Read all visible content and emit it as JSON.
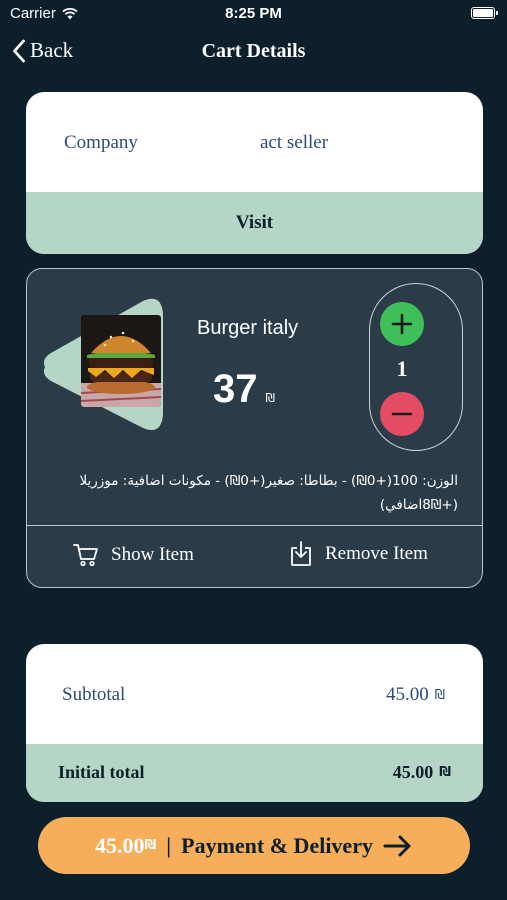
{
  "status_bar": {
    "carrier": "Carrier",
    "time": "8:25 PM"
  },
  "nav": {
    "back_label": "Back",
    "title": "Cart Details"
  },
  "company": {
    "label": "Company",
    "value": "act seller",
    "visit_label": "Visit"
  },
  "item": {
    "name": "Burger italy",
    "price": "37",
    "currency": "₪",
    "quantity": "1",
    "options_line1": "الوزن: 100(+0₪) - بطاطا: صغير(+0₪) - مكونات اضافية: موزريلا",
    "options_line2": "(+8₪اضافي)",
    "show_label": "Show Item",
    "remove_label": "Remove Item"
  },
  "totals": {
    "subtotal_label": "Subtotal",
    "subtotal_value": "45.00",
    "initial_label": "Initial total",
    "initial_value": "45.00",
    "currency": "₪"
  },
  "payment": {
    "amount": "45.00",
    "currency": "₪",
    "separator": "|",
    "label": "Payment & Delivery"
  },
  "colors": {
    "background": "#0d1f2a",
    "card_dark": "#2b3b47",
    "mint": "#b5d6c6",
    "accent_orange": "#f6ae5a",
    "plus_green": "#3fbf5a",
    "minus_red": "#e34c63",
    "text_blue": "#2c4a7c"
  },
  "icons": {
    "wifi": "wifi-icon",
    "battery": "battery-icon",
    "back": "chevron-left-icon",
    "plus": "plus-icon",
    "minus": "minus-icon",
    "cart": "cart-icon",
    "remove": "download-tray-icon",
    "arrow": "arrow-right-icon"
  }
}
